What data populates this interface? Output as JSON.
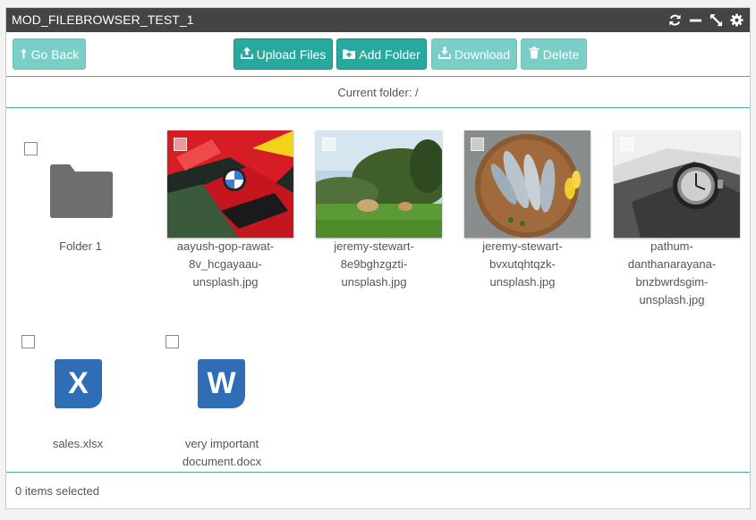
{
  "window": {
    "title": "MOD_FILEBROWSER_TEST_1"
  },
  "titlebar_icons": [
    "refresh-icon",
    "minimize-icon",
    "resize-icon",
    "settings-icon"
  ],
  "toolbar": {
    "go_back": "Go Back",
    "upload": "Upload Files",
    "add_folder": "Add Folder",
    "download": "Download",
    "delete": "Delete"
  },
  "current_folder": {
    "label": "Current folder: /"
  },
  "files": [
    {
      "name": "Folder 1",
      "type": "folder",
      "lines": [
        "Folder 1"
      ]
    },
    {
      "name": "aayush-gop-rawat-8v_hcgayaau-unsplash.jpg",
      "type": "image",
      "lines": [
        "aayush-gop-rawat-",
        "8v_hcgayaau-",
        "unsplash.jpg"
      ]
    },
    {
      "name": "jeremy-stewart-8e9bghzgzti-unsplash.jpg",
      "type": "image",
      "lines": [
        "jeremy-stewart-",
        "8e9bghzgzti-",
        "unsplash.jpg"
      ]
    },
    {
      "name": "jeremy-stewart-bvxutqhtqzk-unsplash.jpg",
      "type": "image",
      "lines": [
        "jeremy-stewart-",
        "bvxutqhtqzk-",
        "unsplash.jpg"
      ]
    },
    {
      "name": "pathum-danthanarayana-bnzbwrdsgim-unsplash.jpg",
      "type": "image",
      "lines": [
        "pathum-",
        "danthanarayana-",
        "bnzbwrdsgim-",
        "unsplash.jpg"
      ]
    },
    {
      "name": "sales.xlsx",
      "type": "xlsx",
      "lines": [
        "sales.xlsx"
      ],
      "icon_letter": "X"
    },
    {
      "name": "very important document.docx",
      "type": "docx",
      "lines": [
        "very important",
        "document.docx"
      ],
      "icon_letter": "W"
    }
  ],
  "footer": {
    "status": "0 items selected"
  },
  "colors": {
    "accent": "#28a99e",
    "accent_light": "#79cfc6",
    "titlebar": "#444444",
    "office_blue": "#2f6eb7",
    "folder": "#6e6e6e"
  }
}
